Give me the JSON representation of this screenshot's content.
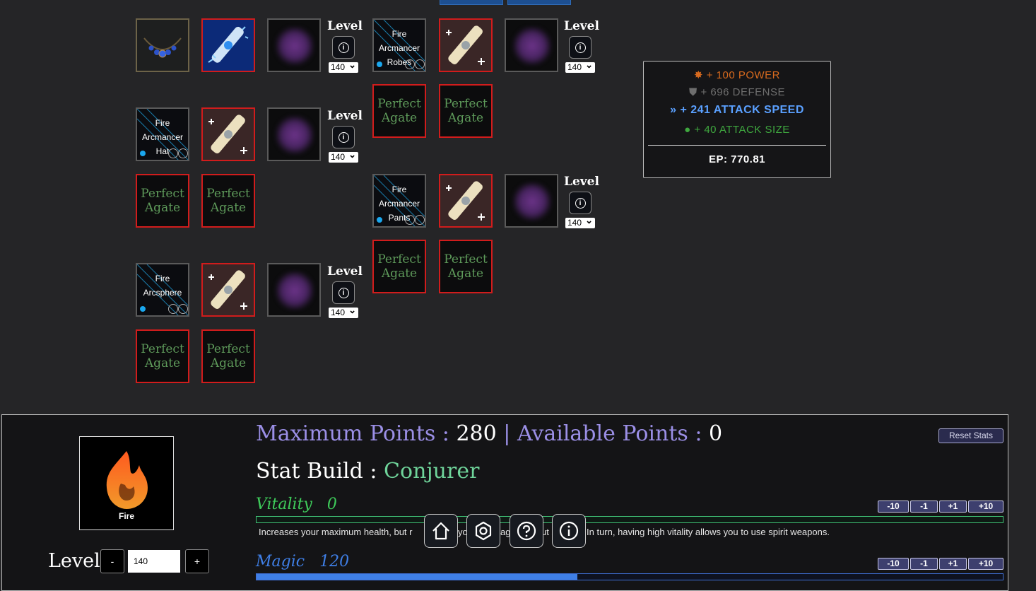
{
  "equipment": {
    "level_label": "Level",
    "level_value": "140",
    "gem_text_line1": "Perfect",
    "gem_text_line2": "Agate",
    "hat_name_line1": "Fire",
    "hat_name_line2": "Arcmancer",
    "hat_name_line3": "Hat",
    "robes_name_line1": "Fire",
    "robes_name_line2": "Arcmancer",
    "robes_name_line3": "Robes",
    "pants_name_line1": "Fire",
    "pants_name_line2": "Arcmancer",
    "pants_name_line3": "Pants",
    "sphere_name_line1": "Fire",
    "sphere_name_line2": "Arcsphere"
  },
  "stats_summary": {
    "power": "+ 100 POWER",
    "defense": "+ 696 DEFENSE",
    "attack_speed": "+ 241 ATTACK SPEED",
    "attack_size": "+ 40 ATTACK SIZE",
    "ep": "EP: 770.81",
    "colors": {
      "power": "#d86a1e",
      "defense": "#6e6e6e",
      "attack_speed": "#5aa0ff",
      "attack_size": "#3fa83f"
    }
  },
  "stat_panel": {
    "element_name": "Fire",
    "level_label": "Level",
    "level_minus": "-",
    "level_plus": "+",
    "level_value": "140",
    "points_line": "Maximum Points : 280 | Available Points : 0",
    "max_points_label": "Maximum Points :",
    "max_points_value": "280",
    "separator": "|",
    "available_points_label": "Available Points :",
    "available_points_value": "0",
    "build_label": "Stat Build :",
    "build_value": "Conjurer",
    "reset_label": "Reset Stats",
    "vitality": {
      "name": "Vitality",
      "value": "0",
      "fill_fraction": 0,
      "description_left": "Increases your maximum health, but r",
      "description_mid1": "yo",
      "description_mid2": "ag",
      "description_mid3": "ut s",
      "description_right": "In turn, having high vitality allows you to use spirit weapons."
    },
    "magic": {
      "name": "Magic",
      "value": "120",
      "fill_fraction": 0.43
    },
    "buttons": [
      "-10",
      "-1",
      "+1",
      "+10"
    ]
  },
  "nav_icons": [
    "home-icon",
    "settings-icon",
    "help-icon",
    "info-icon"
  ]
}
